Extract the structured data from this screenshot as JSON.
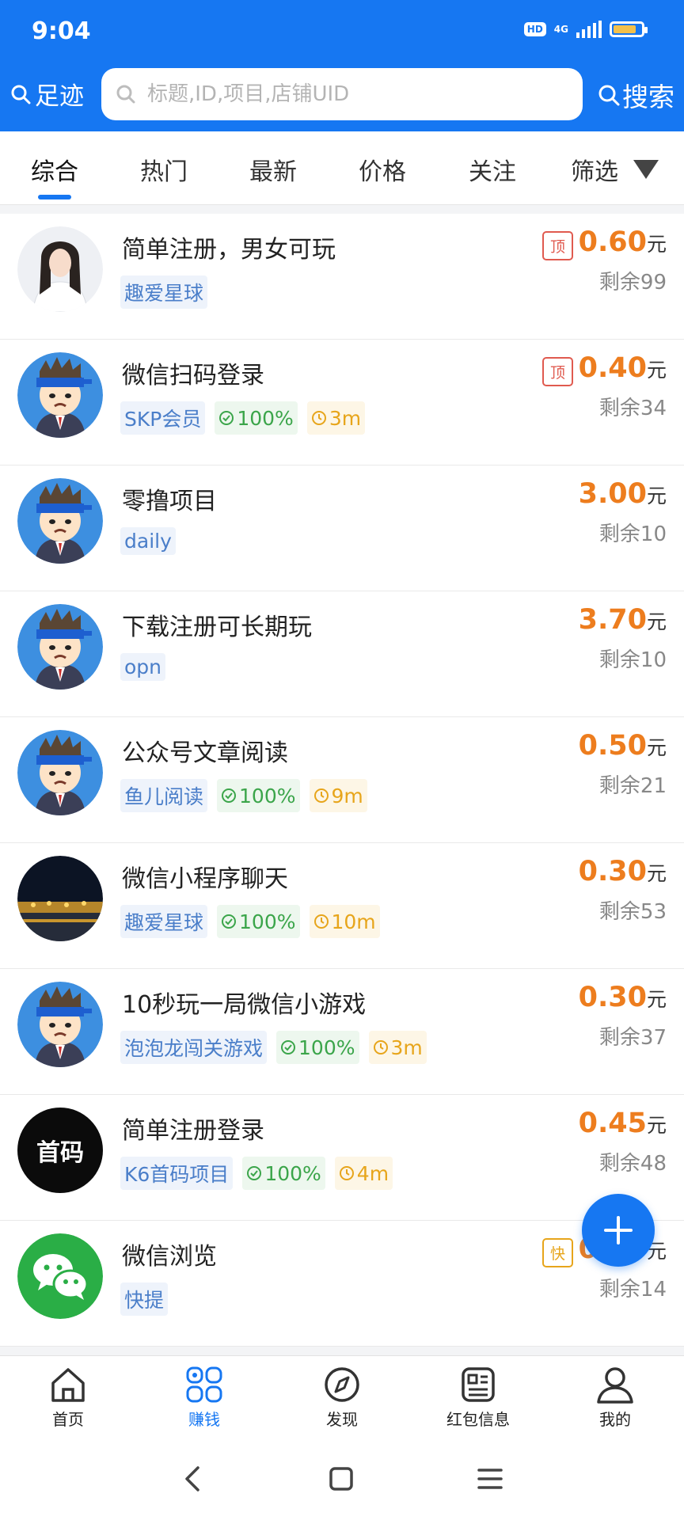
{
  "status_bar": {
    "time": "9:04",
    "hd": "HD",
    "network": "4G"
  },
  "header": {
    "footprint_label": "足迹",
    "search_placeholder": "标题,ID,项目,店铺UID",
    "search_label": "搜索"
  },
  "tabs": [
    "综合",
    "热门",
    "最新",
    "价格",
    "关注",
    "筛选"
  ],
  "tasks": [
    {
      "title": "简单注册，男女可玩",
      "tags": [
        {
          "type": "project",
          "text": "趣爱星球"
        }
      ],
      "price": "0.60",
      "unit": "元",
      "remaining": "剩余99",
      "badge": "顶",
      "avatar": "woman-photo"
    },
    {
      "title": "微信扫码登录",
      "tags": [
        {
          "type": "project",
          "text": "SKP会员"
        },
        {
          "type": "rate",
          "text": "100%"
        },
        {
          "type": "time",
          "text": "3m"
        }
      ],
      "price": "0.40",
      "unit": "元",
      "remaining": "剩余34",
      "badge": "顶",
      "avatar": "cartoon-man"
    },
    {
      "title": "零撸项目",
      "tags": [
        {
          "type": "project",
          "text": "daily"
        }
      ],
      "price": "3.00",
      "unit": "元",
      "remaining": "剩余10",
      "badge": "",
      "avatar": "cartoon-man"
    },
    {
      "title": "下载注册可长期玩",
      "tags": [
        {
          "type": "project",
          "text": "opn"
        }
      ],
      "price": "3.70",
      "unit": "元",
      "remaining": "剩余10",
      "badge": "",
      "avatar": "cartoon-man"
    },
    {
      "title": "公众号文章阅读",
      "tags": [
        {
          "type": "project",
          "text": "鱼儿阅读"
        },
        {
          "type": "rate",
          "text": "100%"
        },
        {
          "type": "time",
          "text": "9m"
        }
      ],
      "price": "0.50",
      "unit": "元",
      "remaining": "剩余21",
      "badge": "",
      "avatar": "cartoon-man"
    },
    {
      "title": "微信小程序聊天",
      "tags": [
        {
          "type": "project",
          "text": "趣爱星球"
        },
        {
          "type": "rate",
          "text": "100%"
        },
        {
          "type": "time",
          "text": "10m"
        }
      ],
      "price": "0.30",
      "unit": "元",
      "remaining": "剩余53",
      "badge": "",
      "avatar": "night-scene"
    },
    {
      "title": "10秒玩一局微信小游戏",
      "tags": [
        {
          "type": "project",
          "text": "泡泡龙闯关游戏"
        },
        {
          "type": "rate",
          "text": "100%"
        },
        {
          "type": "time",
          "text": "3m"
        }
      ],
      "price": "0.30",
      "unit": "元",
      "remaining": "剩余37",
      "badge": "",
      "avatar": "cartoon-man"
    },
    {
      "title": "简单注册登录",
      "tags": [
        {
          "type": "project",
          "text": "K6首码项目"
        },
        {
          "type": "rate",
          "text": "100%"
        },
        {
          "type": "time",
          "text": "4m"
        }
      ],
      "price": "0.45",
      "unit": "元",
      "remaining": "剩余48",
      "badge": "",
      "avatar": "shouma-logo",
      "avatar_text": "首码"
    },
    {
      "title": "微信浏览",
      "tags": [
        {
          "type": "project",
          "text": "快提"
        }
      ],
      "price": "0.30",
      "unit": "元",
      "remaining": "剩余14",
      "badge": "快",
      "avatar": "wechat-logo"
    }
  ],
  "bottom_nav": [
    {
      "label": "首页",
      "icon": "home-icon",
      "active": false
    },
    {
      "label": "赚钱",
      "icon": "grid-icon",
      "active": true
    },
    {
      "label": "发现",
      "icon": "compass-icon",
      "active": false
    },
    {
      "label": "红包信息",
      "icon": "news-icon",
      "active": false
    },
    {
      "label": "我的",
      "icon": "user-icon",
      "active": false
    }
  ],
  "colors": {
    "primary": "#1677f2",
    "price": "#ed7d1e",
    "top_badge": "#e05a4f",
    "fast_badge": "#e7a51b",
    "tag_green": "#3ba54a",
    "tag_yellow": "#e7a51b",
    "tag_blue": "#4a7ec9"
  }
}
